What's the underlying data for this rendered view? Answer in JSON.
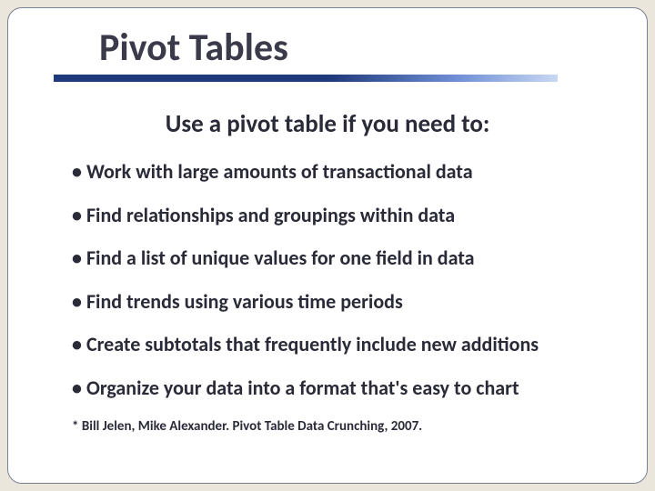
{
  "slide": {
    "title": "Pivot Tables",
    "subtitle": "Use a pivot table if you need to:",
    "bullets": [
      "Work with large amounts of transactional data",
      "Find relationships and groupings within data",
      "Find a list of unique values for one field in data",
      "Find trends using various time periods",
      "Create subtotals that frequently include new additions",
      "Organize your data into a format that's easy to chart"
    ],
    "footnote": "* Bill Jelen, Mike Alexander. Pivot Table Data Crunching, 2007."
  }
}
